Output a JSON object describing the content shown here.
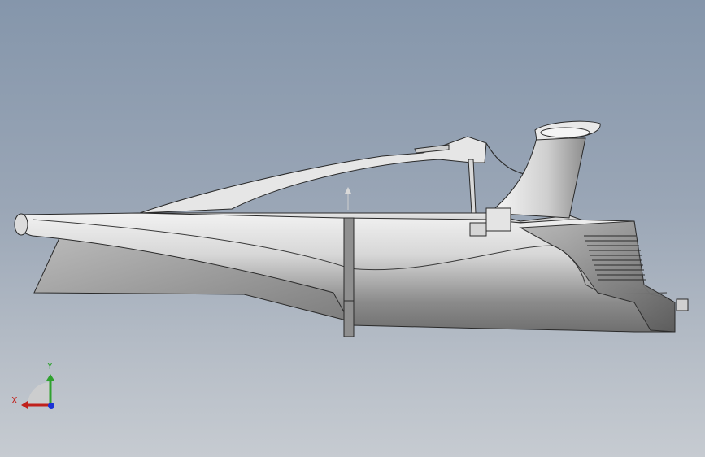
{
  "viewport": {
    "background_top": "#8596ab",
    "background_bottom": "#c6cbd1"
  },
  "model": {
    "description_icon": "boat-3d-model-icon"
  },
  "triad": {
    "x_label": "X",
    "y_label": "Y",
    "x_color": "#c0211c",
    "y_color": "#2fa12f",
    "z_color": "#1a33d6"
  }
}
